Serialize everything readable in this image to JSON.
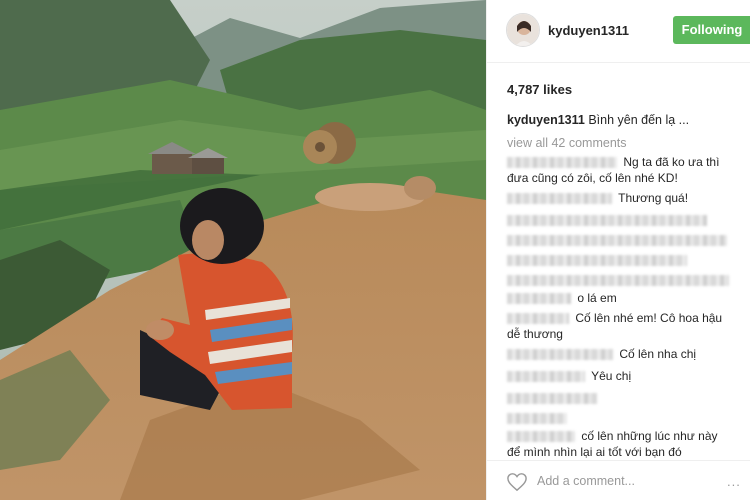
{
  "post": {
    "username": "kyduyen1311",
    "follow_label": "Following",
    "likes": "4,787 likes",
    "caption_user": "kyduyen1311",
    "caption_text": "Bình yên đến lạ ...",
    "view_all": "view all 42 comments"
  },
  "comments": [
    "Ng ta đã ko ưa thì",
    "đưa cũng có zôi, cố lên nhé KD!",
    "Thương quá!",
    "o lá em",
    "Cố lên nhé em! Cô hoa hậu",
    "dễ thương",
    "Cố lên nha chị",
    "Yêu chị",
    "cố lên những lúc như này",
    "để mình nhìn lại ai tốt với bạn đó"
  ],
  "footer": {
    "add_comment_placeholder": "Add a comment...",
    "more_dots": "..."
  },
  "icons": [
    "heart-icon",
    "avatar"
  ]
}
